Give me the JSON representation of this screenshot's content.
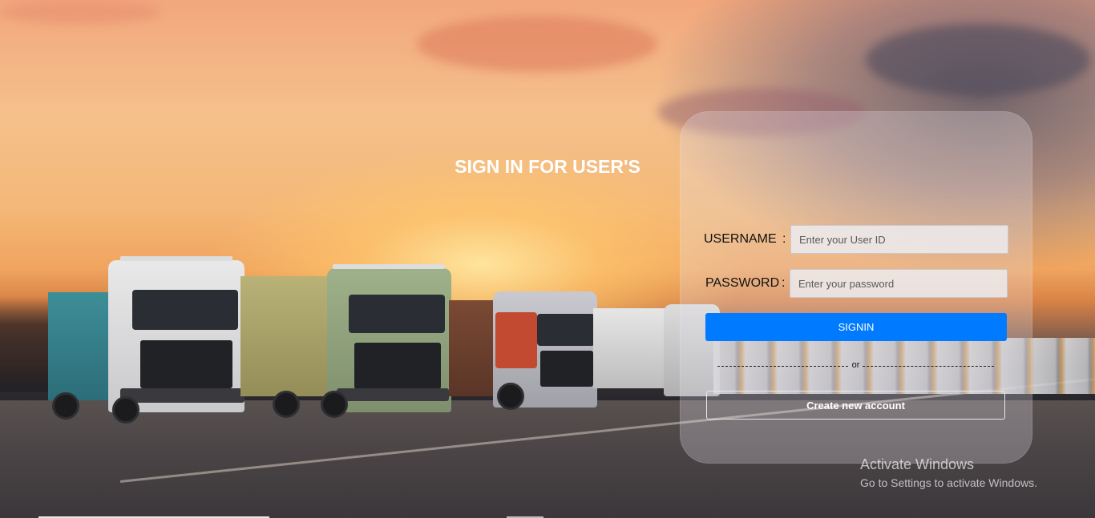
{
  "login": {
    "title": "SIGN IN FOR USER'S",
    "username_label": "USERNAME",
    "username_colon": ":",
    "username_placeholder": "Enter your User ID",
    "username_value": "",
    "password_label": "PASSWORD",
    "password_colon": ":",
    "password_placeholder": "Enter your password",
    "password_value": "",
    "signin_label": "SIGNIN",
    "or_text": "or",
    "create_account_label": "Create new account"
  },
  "watermark": {
    "title": "Activate Windows",
    "subtitle": "Go to Settings to activate Windows."
  },
  "colors": {
    "signin_button": "#007bff",
    "title_text": "#ffffff",
    "label_text": "#111111"
  },
  "background": {
    "scene": "sunset-truck-fleet"
  }
}
